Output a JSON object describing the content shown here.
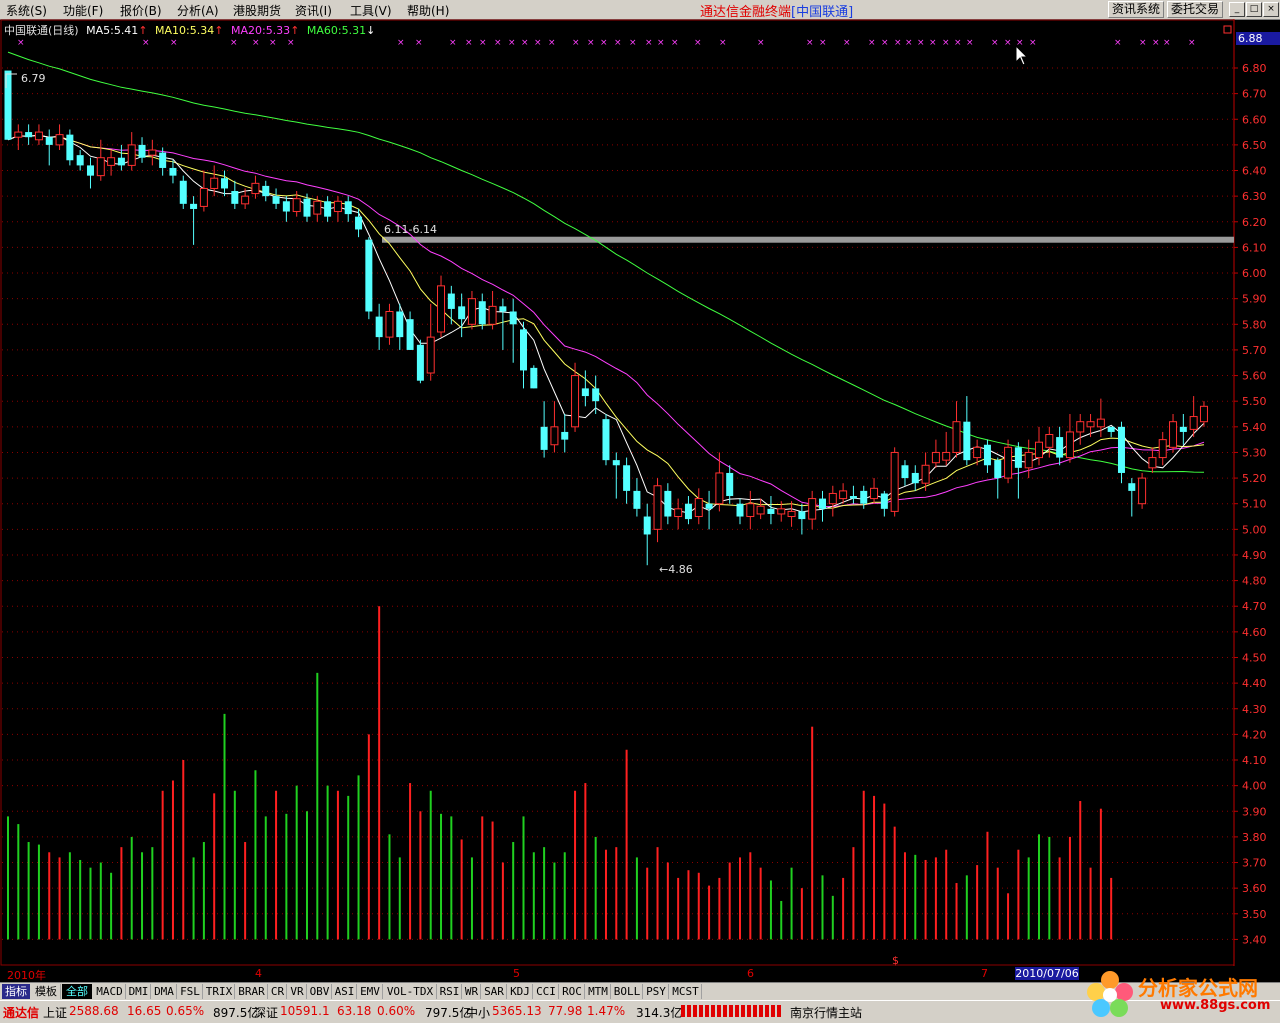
{
  "menu": [
    "系统(S)",
    "功能(F)",
    "报价(B)",
    "分析(A)",
    "港股期货",
    "资讯(I)",
    "工具(V)",
    "帮助(H)"
  ],
  "app_title": {
    "main": "通达信金融终端",
    "sub": "[中国联通]"
  },
  "top_buttons": {
    "info": "资讯系统",
    "trade": "委托交易"
  },
  "window_controls": {
    "min": "_",
    "max": "□",
    "close": "×"
  },
  "info": {
    "stock": "中国联通(日线)",
    "ma5": "MA5:5.41",
    "ma10": "MA10:5.34",
    "ma20": "MA20:5.33",
    "ma60": "MA60:5.31"
  },
  "current_price": "6.88",
  "annotations": {
    "high": "6.79",
    "low": "←4.86",
    "range": "6.11-6.14"
  },
  "axis_months": [
    "2010年",
    "4",
    "5",
    "6",
    "7"
  ],
  "date_label": "2010/07/06",
  "y_ticks": [
    "6.80",
    "6.70",
    "6.60",
    "6.50",
    "6.40",
    "6.30",
    "6.20",
    "6.10",
    "6.00",
    "5.90",
    "5.80",
    "5.70",
    "5.60",
    "5.50",
    "5.40",
    "5.30",
    "5.20",
    "5.10",
    "5.00",
    "4.90",
    "4.80",
    "4.70",
    "4.60",
    "4.50",
    "4.40",
    "4.30",
    "4.20",
    "4.10",
    "4.00",
    "3.90",
    "3.80",
    "3.70",
    "3.60",
    "3.50",
    "3.40"
  ],
  "tabs": [
    "指标",
    "模板",
    "全部",
    "MACD",
    "DMI",
    "DMA",
    "FSL",
    "TRIX",
    "BRAR",
    "CR",
    "VR",
    "OBV",
    "ASI",
    "EMV",
    "VOL-TDX",
    "RSI",
    "WR",
    "SAR",
    "KDJ",
    "CCI",
    "ROC",
    "MTM",
    "BOLL",
    "PSY",
    "MCST"
  ],
  "status": {
    "brand": "通达信",
    "sh_label": "上证",
    "sh_val": "2588.68",
    "sh_chg": "16.65",
    "sh_pct": "0.65%",
    "sh_amt": "897.5亿",
    "sz_label": "深证",
    "sz_val": "10591.1",
    "sz_chg": "63.18",
    "sz_pct": "0.60%",
    "sz_amt": "797.5亿",
    "zx_label": "中小",
    "zx_val": "5365.13",
    "zx_chg": "77.98",
    "zx_pct": "1.47%",
    "zx_amt": "314.3亿",
    "server": "南京行情主站"
  },
  "logo": {
    "text": "分析家公式网",
    "url": "www.88gs.com"
  },
  "colors": {
    "up": "#ff3030",
    "down": "#54ffff",
    "ma5": "#ffffff",
    "ma10": "#ffff60",
    "ma20": "#ff40ff",
    "ma60": "#40ff40",
    "grid": "#8b0000",
    "vol_up": "#ff2020",
    "vol_down": "#20d020"
  },
  "chart_data": {
    "type": "candlestick",
    "title": "中国联通(日线)",
    "ylim": [
      4.8,
      6.88
    ],
    "candles": [
      [
        6.79,
        6.52,
        6.55,
        6.75
      ],
      [
        6.53,
        6.55,
        6.48,
        6.58
      ],
      [
        6.55,
        6.53,
        6.5,
        6.58
      ],
      [
        6.52,
        6.55,
        6.5,
        6.58
      ],
      [
        6.53,
        6.5,
        6.42,
        6.56
      ],
      [
        6.5,
        6.54,
        6.48,
        6.58
      ],
      [
        6.54,
        6.44,
        6.42,
        6.56
      ],
      [
        6.46,
        6.42,
        6.4,
        6.48
      ],
      [
        6.42,
        6.38,
        6.33,
        6.45
      ],
      [
        6.38,
        6.45,
        6.36,
        6.52
      ],
      [
        6.42,
        6.45,
        6.38,
        6.48
      ],
      [
        6.45,
        6.42,
        6.4,
        6.5
      ],
      [
        6.42,
        6.5,
        6.4,
        6.55
      ],
      [
        6.5,
        6.45,
        6.43,
        6.53
      ],
      [
        6.46,
        6.48,
        6.42,
        6.52
      ],
      [
        6.47,
        6.41,
        6.38,
        6.49
      ],
      [
        6.41,
        6.38,
        6.35,
        6.44
      ],
      [
        6.36,
        6.27,
        6.25,
        6.38
      ],
      [
        6.27,
        6.25,
        6.11,
        6.3
      ],
      [
        6.26,
        6.33,
        6.24,
        6.4
      ],
      [
        6.33,
        6.37,
        6.3,
        6.42
      ],
      [
        6.37,
        6.33,
        6.3,
        6.4
      ],
      [
        6.32,
        6.27,
        6.25,
        6.36
      ],
      [
        6.27,
        6.3,
        6.25,
        6.33
      ],
      [
        6.31,
        6.35,
        6.29,
        6.38
      ],
      [
        6.34,
        6.3,
        6.28,
        6.36
      ],
      [
        6.3,
        6.27,
        6.25,
        6.33
      ],
      [
        6.28,
        6.24,
        6.2,
        6.3
      ],
      [
        6.24,
        6.29,
        6.22,
        6.32
      ],
      [
        6.29,
        6.22,
        6.2,
        6.31
      ],
      [
        6.23,
        6.28,
        6.2,
        6.3
      ],
      [
        6.28,
        6.22,
        6.2,
        6.3
      ],
      [
        6.24,
        6.28,
        6.2,
        6.3
      ],
      [
        6.28,
        6.23,
        6.2,
        6.3
      ],
      [
        6.22,
        6.17,
        6.14,
        6.25
      ],
      [
        6.13,
        5.85,
        5.82,
        6.14
      ],
      [
        5.83,
        5.75,
        5.7,
        5.88
      ],
      [
        5.75,
        5.85,
        5.72,
        5.88
      ],
      [
        5.85,
        5.75,
        5.7,
        5.88
      ],
      [
        5.82,
        5.7,
        5.7,
        5.85
      ],
      [
        5.72,
        5.58,
        5.57,
        5.74
      ],
      [
        5.61,
        5.75,
        5.58,
        5.88
      ],
      [
        5.77,
        5.95,
        5.75,
        5.99
      ],
      [
        5.92,
        5.86,
        5.8,
        5.95
      ],
      [
        5.87,
        5.82,
        5.75,
        5.92
      ],
      [
        5.8,
        5.9,
        5.78,
        5.93
      ],
      [
        5.89,
        5.8,
        5.78,
        5.92
      ],
      [
        5.8,
        5.87,
        5.78,
        5.93
      ],
      [
        5.87,
        5.85,
        5.7,
        5.9
      ],
      [
        5.85,
        5.8,
        5.65,
        5.9
      ],
      [
        5.78,
        5.62,
        5.55,
        5.81
      ],
      [
        5.63,
        5.55,
        5.55,
        5.64
      ],
      [
        5.4,
        5.31,
        5.28,
        5.5
      ],
      [
        5.33,
        5.4,
        5.3,
        5.5
      ],
      [
        5.38,
        5.35,
        5.3,
        5.45
      ],
      [
        5.4,
        5.6,
        5.38,
        5.65
      ],
      [
        5.55,
        5.52,
        5.48,
        5.62
      ],
      [
        5.55,
        5.5,
        5.45,
        5.6
      ],
      [
        5.43,
        5.27,
        5.25,
        5.45
      ],
      [
        5.27,
        5.25,
        5.12,
        5.3
      ],
      [
        5.25,
        5.15,
        5.1,
        5.28
      ],
      [
        5.15,
        5.08,
        5.05,
        5.2
      ],
      [
        5.05,
        4.98,
        4.86,
        5.1
      ],
      [
        5.0,
        5.17,
        4.95,
        5.2
      ],
      [
        5.15,
        5.05,
        5.02,
        5.18
      ],
      [
        5.05,
        5.08,
        5.0,
        5.12
      ],
      [
        5.1,
        5.04,
        5.02,
        5.13
      ],
      [
        5.05,
        5.12,
        5.02,
        5.16
      ],
      [
        5.1,
        5.08,
        5.0,
        5.15
      ],
      [
        5.1,
        5.22,
        5.07,
        5.3
      ],
      [
        5.22,
        5.13,
        5.1,
        5.25
      ],
      [
        5.1,
        5.05,
        5.02,
        5.12
      ],
      [
        5.05,
        5.1,
        5.0,
        5.15
      ],
      [
        5.06,
        5.09,
        5.04,
        5.12
      ],
      [
        5.08,
        5.06,
        5.02,
        5.13
      ],
      [
        5.06,
        5.08,
        5.03,
        5.11
      ],
      [
        5.05,
        5.07,
        5.01,
        5.11
      ],
      [
        5.07,
        5.04,
        4.98,
        5.1
      ],
      [
        5.04,
        5.12,
        5.0,
        5.15
      ],
      [
        5.12,
        5.08,
        5.03,
        5.15
      ],
      [
        5.1,
        5.14,
        5.05,
        5.17
      ],
      [
        5.12,
        5.15,
        5.1,
        5.18
      ],
      [
        5.13,
        5.12,
        5.1,
        5.17
      ],
      [
        5.15,
        5.1,
        5.08,
        5.17
      ],
      [
        5.12,
        5.16,
        5.1,
        5.2
      ],
      [
        5.14,
        5.08,
        5.05,
        5.15
      ],
      [
        5.07,
        5.3,
        5.05,
        5.32
      ],
      [
        5.25,
        5.2,
        5.17,
        5.27
      ],
      [
        5.22,
        5.18,
        5.15,
        5.25
      ],
      [
        5.18,
        5.25,
        5.15,
        5.3
      ],
      [
        5.26,
        5.3,
        5.24,
        5.35
      ],
      [
        5.27,
        5.3,
        5.25,
        5.38
      ],
      [
        5.3,
        5.42,
        5.28,
        5.5
      ],
      [
        5.42,
        5.27,
        5.25,
        5.52
      ],
      [
        5.28,
        5.32,
        5.25,
        5.35
      ],
      [
        5.33,
        5.25,
        5.22,
        5.35
      ],
      [
        5.27,
        5.2,
        5.12,
        5.28
      ],
      [
        5.2,
        5.32,
        5.18,
        5.35
      ],
      [
        5.32,
        5.24,
        5.12,
        5.34
      ],
      [
        5.24,
        5.3,
        5.2,
        5.35
      ],
      [
        5.28,
        5.34,
        5.25,
        5.4
      ],
      [
        5.32,
        5.37,
        5.28,
        5.4
      ],
      [
        5.36,
        5.28,
        5.25,
        5.4
      ],
      [
        5.28,
        5.38,
        5.26,
        5.45
      ],
      [
        5.38,
        5.42,
        5.33,
        5.45
      ],
      [
        5.4,
        5.42,
        5.36,
        5.45
      ],
      [
        5.4,
        5.43,
        5.36,
        5.51
      ],
      [
        5.4,
        5.38,
        5.36,
        5.4
      ],
      [
        5.4,
        5.22,
        5.18,
        5.42
      ],
      [
        5.18,
        5.15,
        5.05,
        5.2
      ],
      [
        5.1,
        5.2,
        5.08,
        5.22
      ],
      [
        5.24,
        5.28,
        5.22,
        5.32
      ],
      [
        5.28,
        5.35,
        5.25,
        5.38
      ],
      [
        5.32,
        5.42,
        5.3,
        5.45
      ],
      [
        5.4,
        5.38,
        5.33,
        5.45
      ],
      [
        5.39,
        5.44,
        5.36,
        5.52
      ],
      [
        5.42,
        5.48,
        5.4,
        5.5
      ]
    ],
    "volume_scale": [
      3.4,
      4.7
    ],
    "volume_note": "Volume bars drawn on the lower axis as heights in price-axis units",
    "volume": [
      [
        3.88,
        0
      ],
      [
        3.85,
        0
      ],
      [
        3.78,
        0
      ],
      [
        3.77,
        0
      ],
      [
        3.74,
        1
      ],
      [
        3.72,
        1
      ],
      [
        3.74,
        0
      ],
      [
        3.71,
        0
      ],
      [
        3.68,
        0
      ],
      [
        3.7,
        0
      ],
      [
        3.66,
        0
      ],
      [
        3.76,
        1
      ],
      [
        3.8,
        0
      ],
      [
        3.74,
        0
      ],
      [
        3.76,
        0
      ],
      [
        3.98,
        1
      ],
      [
        4.02,
        1
      ],
      [
        4.1,
        1
      ],
      [
        3.72,
        0
      ],
      [
        3.78,
        0
      ],
      [
        3.97,
        1
      ],
      [
        4.28,
        0
      ],
      [
        3.98,
        0
      ],
      [
        3.78,
        1
      ],
      [
        4.06,
        0
      ],
      [
        3.88,
        0
      ],
      [
        3.98,
        1
      ],
      [
        3.89,
        0
      ],
      [
        4.0,
        0
      ],
      [
        3.9,
        0
      ],
      [
        4.44,
        0
      ],
      [
        4.0,
        0
      ],
      [
        3.98,
        1
      ],
      [
        3.96,
        0
      ],
      [
        4.04,
        0
      ],
      [
        4.2,
        1
      ],
      [
        4.7,
        1
      ],
      [
        3.81,
        0
      ],
      [
        3.72,
        0
      ],
      [
        4.01,
        1
      ],
      [
        3.9,
        1
      ],
      [
        3.98,
        0
      ],
      [
        3.89,
        0
      ],
      [
        3.88,
        0
      ],
      [
        3.79,
        1
      ],
      [
        3.72,
        0
      ],
      [
        3.88,
        1
      ],
      [
        3.86,
        1
      ],
      [
        3.7,
        1
      ],
      [
        3.78,
        0
      ],
      [
        3.88,
        0
      ],
      [
        3.74,
        0
      ],
      [
        3.76,
        0
      ],
      [
        3.7,
        0
      ],
      [
        3.74,
        0
      ],
      [
        3.98,
        1
      ],
      [
        4.01,
        1
      ],
      [
        3.8,
        0
      ],
      [
        3.75,
        1
      ],
      [
        3.76,
        1
      ],
      [
        4.14,
        1
      ],
      [
        3.72,
        0
      ],
      [
        3.68,
        1
      ],
      [
        3.76,
        1
      ],
      [
        3.7,
        1
      ],
      [
        3.64,
        1
      ],
      [
        3.67,
        1
      ],
      [
        3.66,
        1
      ],
      [
        3.61,
        1
      ],
      [
        3.64,
        1
      ],
      [
        3.7,
        1
      ],
      [
        3.72,
        1
      ],
      [
        3.74,
        1
      ],
      [
        3.68,
        1
      ],
      [
        3.63,
        0
      ],
      [
        3.55,
        0
      ],
      [
        3.68,
        0
      ],
      [
        3.6,
        1
      ],
      [
        4.23,
        1
      ],
      [
        3.65,
        0
      ],
      [
        3.57,
        0
      ],
      [
        3.64,
        1
      ],
      [
        3.76,
        1
      ],
      [
        3.98,
        1
      ],
      [
        3.96,
        1
      ],
      [
        3.93,
        1
      ],
      [
        3.84,
        1
      ],
      [
        3.74,
        1
      ],
      [
        3.73,
        0
      ],
      [
        3.71,
        1
      ],
      [
        3.72,
        1
      ],
      [
        3.75,
        1
      ],
      [
        3.62,
        1
      ],
      [
        3.65,
        0
      ],
      [
        3.69,
        1
      ],
      [
        3.82,
        1
      ],
      [
        3.68,
        1
      ],
      [
        3.58,
        1
      ],
      [
        3.75,
        1
      ],
      [
        3.72,
        0
      ],
      [
        3.81,
        0
      ],
      [
        3.8,
        0
      ],
      [
        3.72,
        1
      ],
      [
        3.8,
        1
      ],
      [
        3.94,
        1
      ],
      [
        3.68,
        1
      ],
      [
        3.91,
        1
      ],
      [
        3.64,
        1
      ]
    ],
    "x_axis": {
      "month_labels": [
        "2010年",
        "4",
        "5",
        "6",
        "7"
      ]
    }
  }
}
